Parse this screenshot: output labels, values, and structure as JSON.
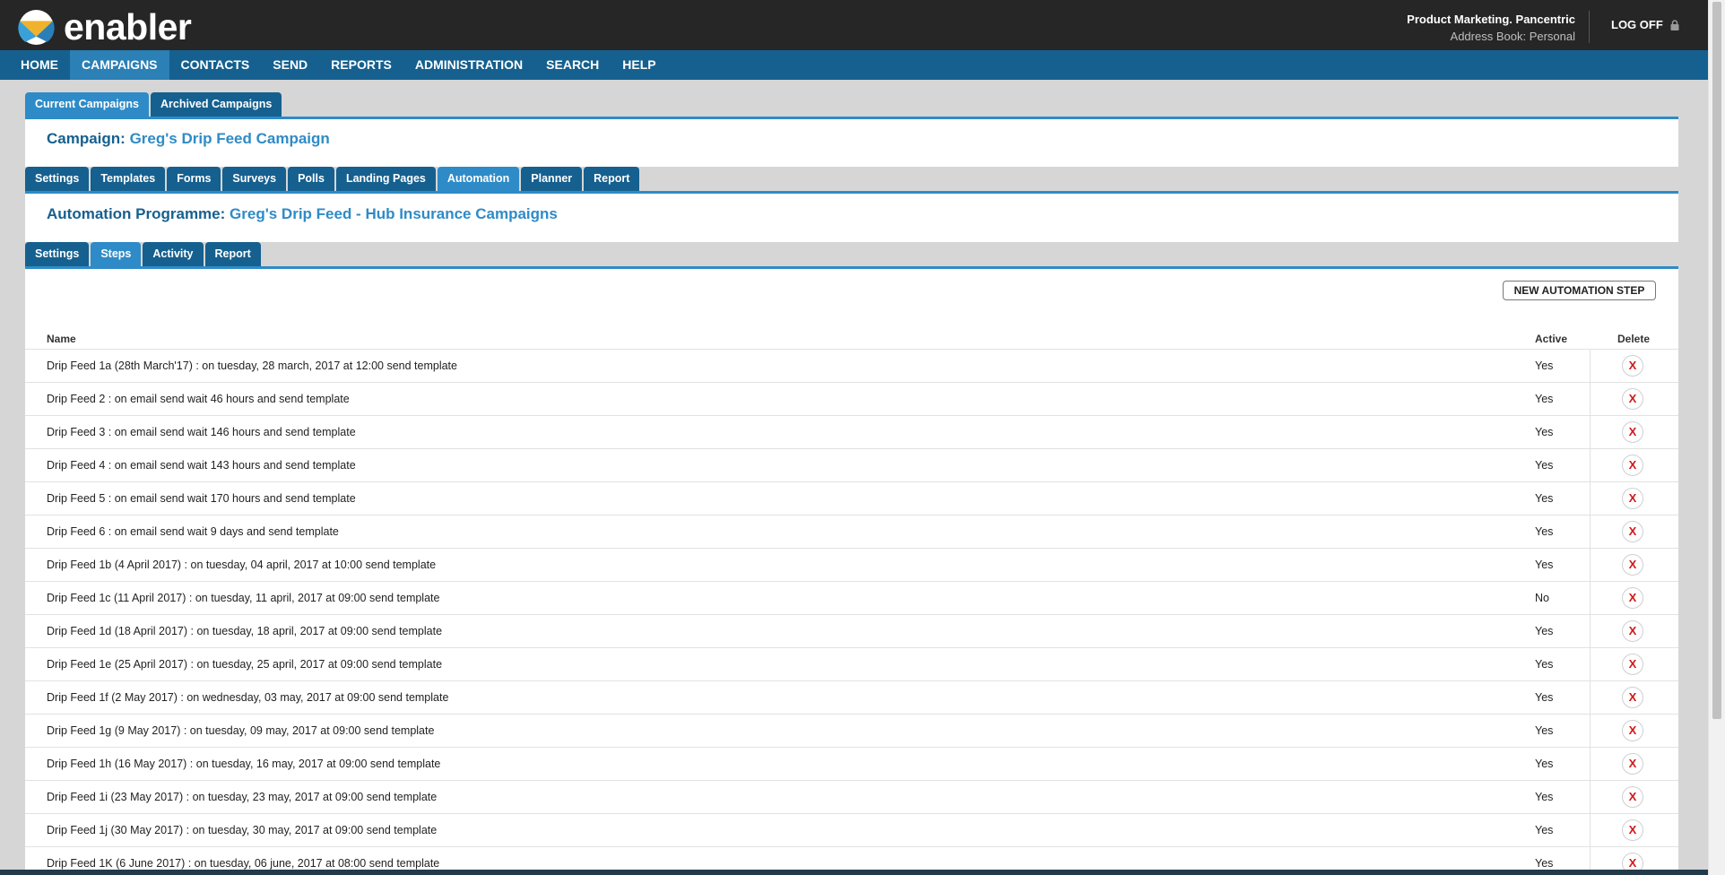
{
  "app": {
    "brand": "enabler"
  },
  "user": {
    "name": "Product Marketing. Pancentric",
    "address_book": "Address Book: Personal",
    "logoff_label": "LOG OFF"
  },
  "nav": [
    "HOME",
    "CAMPAIGNS",
    "CONTACTS",
    "SEND",
    "REPORTS",
    "ADMINISTRATION",
    "SEARCH",
    "HELP"
  ],
  "campaign_tabs": [
    "Current Campaigns",
    "Archived Campaigns"
  ],
  "campaign": {
    "label": "Campaign:",
    "name": "Greg's Drip Feed Campaign"
  },
  "campaign_section_tabs": [
    "Settings",
    "Templates",
    "Forms",
    "Surveys",
    "Polls",
    "Landing Pages",
    "Automation",
    "Planner",
    "Report"
  ],
  "programme": {
    "label": "Automation Programme:",
    "name": "Greg's Drip Feed - Hub Insurance Campaigns"
  },
  "programme_tabs": [
    "Settings",
    "Steps",
    "Activity",
    "Report"
  ],
  "new_step_label": "NEW AUTOMATION STEP",
  "table": {
    "columns": {
      "name": "Name",
      "active": "Active",
      "delete": "Delete"
    },
    "delete_glyph": "X",
    "rows": [
      {
        "name": "Drip Feed 1a (28th March'17) : on tuesday, 28 march, 2017 at 12:00 send template",
        "active": "Yes"
      },
      {
        "name": "Drip Feed 2 : on email send wait 46 hours and send template",
        "active": "Yes"
      },
      {
        "name": "Drip Feed 3 : on email send wait 146 hours and send template",
        "active": "Yes"
      },
      {
        "name": "Drip Feed 4 : on email send wait 143 hours and send template",
        "active": "Yes"
      },
      {
        "name": "Drip Feed 5 : on email send wait 170 hours and send template",
        "active": "Yes"
      },
      {
        "name": "Drip Feed 6 : on email send wait 9 days and send template",
        "active": "Yes"
      },
      {
        "name": "Drip Feed 1b (4 April 2017) : on tuesday, 04 april, 2017 at 10:00 send template",
        "active": "Yes"
      },
      {
        "name": "Drip Feed 1c (11 April 2017) : on tuesday, 11 april, 2017 at 09:00 send template",
        "active": "No"
      },
      {
        "name": "Drip Feed 1d (18 April 2017) : on tuesday, 18 april, 2017 at 09:00 send template",
        "active": "Yes"
      },
      {
        "name": "Drip Feed 1e (25 April 2017) : on tuesday, 25 april, 2017 at 09:00 send template",
        "active": "Yes"
      },
      {
        "name": "Drip Feed 1f (2 May 2017) : on wednesday, 03 may, 2017 at 09:00 send template",
        "active": "Yes"
      },
      {
        "name": "Drip Feed 1g (9 May 2017) : on tuesday, 09 may, 2017 at 09:00 send template",
        "active": "Yes"
      },
      {
        "name": "Drip Feed 1h (16 May 2017) : on tuesday, 16 may, 2017 at 09:00 send template",
        "active": "Yes"
      },
      {
        "name": "Drip Feed 1i (23 May 2017) : on tuesday, 23 may, 2017 at 09:00 send template",
        "active": "Yes"
      },
      {
        "name": "Drip Feed 1j (30 May 2017) : on tuesday, 30 may, 2017 at 09:00 send template",
        "active": "Yes"
      },
      {
        "name": "Drip Feed 1K (6 June 2017) : on tuesday, 06 june, 2017 at 08:00 send template",
        "active": "Yes"
      }
    ]
  }
}
